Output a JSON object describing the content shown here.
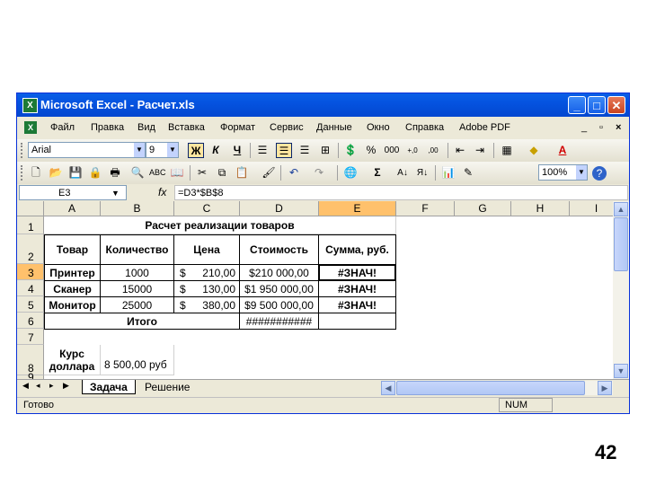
{
  "window": {
    "title": "Microsoft Excel - Расчет.xls",
    "minimize": "_",
    "maximize": "□",
    "close": "✕"
  },
  "menu": [
    "Файл",
    "Правка",
    "Вид",
    "Вставка",
    "Формат",
    "Сервис",
    "Данные",
    "Окно",
    "Справка",
    "Adobe PDF"
  ],
  "menu_doc_controls": [
    "_",
    "▫",
    "×"
  ],
  "format_toolbar": {
    "font": "Arial",
    "size": "9",
    "bold": "Ж",
    "italic": "К",
    "underline": "Ч",
    "currency": "%",
    "thousands": "000",
    "dec_inc": "+,0",
    "dec_dec": ",00"
  },
  "standard_toolbar": {
    "sum": "Σ",
    "zoom": "100%",
    "help": "?"
  },
  "formula_bar": {
    "name_box": "E3",
    "fx": "fx",
    "formula": "=D3*$B$8"
  },
  "columns": [
    "A",
    "B",
    "C",
    "D",
    "E",
    "F",
    "G",
    "H",
    "I"
  ],
  "rows": [
    "1",
    "2",
    "3",
    "4",
    "5",
    "6",
    "7",
    "8",
    "9"
  ],
  "sheet": {
    "title": "Расчет реализации товаров",
    "headers": [
      "Товар",
      "Количество",
      "Цена",
      "Стоимость",
      "Сумма, руб."
    ],
    "items": [
      {
        "name": "Принтер",
        "qty": "1000",
        "cur": "$",
        "price": "210,00",
        "cost": "$210 000,00",
        "sum": "#ЗНАЧ!"
      },
      {
        "name": "Сканер",
        "qty": "15000",
        "cur": "$",
        "price": "130,00",
        "cost": "$1 950 000,00",
        "sum": "#ЗНАЧ!"
      },
      {
        "name": "Монитор",
        "qty": "25000",
        "cur": "$",
        "price": "380,00",
        "cost": "$9 500 000,00",
        "sum": "#ЗНАЧ!"
      }
    ],
    "total_label": "Итого",
    "total_value": "###########",
    "rate_label_line1": "Курс",
    "rate_label_line2": "доллара",
    "rate_value": "8 500,00 руб"
  },
  "tabs": [
    "Задача",
    "Решение"
  ],
  "tab_nav": [
    "◀",
    "◂",
    "▸",
    "▶"
  ],
  "status": {
    "ready": "Готово",
    "num": "NUM"
  },
  "slide_number": "42"
}
